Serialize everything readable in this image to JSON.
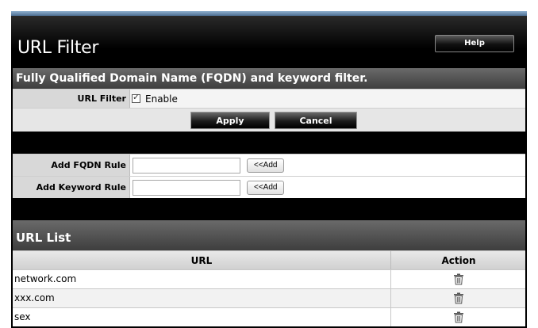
{
  "page": {
    "title": "URL Filter",
    "help_label": "Help"
  },
  "filter_section": {
    "heading": "Fully Qualified Domain Name (FQDN) and keyword filter.",
    "url_filter_label": "URL Filter",
    "enable_label": "Enable",
    "enabled": true,
    "apply_label": "Apply",
    "cancel_label": "Cancel"
  },
  "rules": {
    "fqdn_label": "Add FQDN Rule",
    "fqdn_value": "",
    "keyword_label": "Add Keyword Rule",
    "keyword_value": "",
    "add_label": "<<Add"
  },
  "url_list": {
    "heading": "URL List",
    "columns": [
      "URL",
      "Action"
    ],
    "rows": [
      {
        "url": "network.com",
        "action_icon": "trash-icon"
      },
      {
        "url": "xxx.com",
        "action_icon": "trash-icon"
      },
      {
        "url": "sex",
        "action_icon": "trash-icon"
      }
    ]
  }
}
